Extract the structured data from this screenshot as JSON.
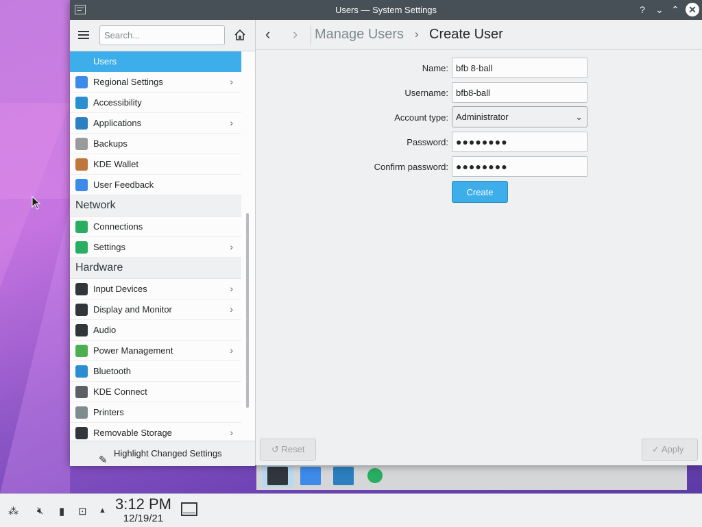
{
  "window": {
    "title": "Users — System Settings",
    "buttons": [
      "?",
      "⌄",
      "⌃",
      "✕"
    ]
  },
  "sidebar": {
    "search_placeholder": "Search...",
    "items_top": [
      {
        "label": "Users",
        "icon": "users-icon",
        "selected": true,
        "has_chevron": false,
        "color": "#3daee9"
      },
      {
        "label": "Regional Settings",
        "icon": "regional-settings-icon",
        "has_chevron": true,
        "color": "#3d8ae9"
      },
      {
        "label": "Accessibility",
        "icon": "accessibility-icon",
        "has_chevron": false,
        "color": "#2a8fd0"
      },
      {
        "label": "Applications",
        "icon": "applications-icon",
        "has_chevron": true,
        "color": "#2d7fc1"
      },
      {
        "label": "Backups",
        "icon": "backups-icon",
        "has_chevron": false,
        "color": "#9a9a9a"
      },
      {
        "label": "KDE Wallet",
        "icon": "kde-wallet-icon",
        "has_chevron": false,
        "color": "#c0763a"
      },
      {
        "label": "User Feedback",
        "icon": "user-feedback-icon",
        "has_chevron": false,
        "color": "#3d8ae9"
      }
    ],
    "category_network": "Network",
    "items_network": [
      {
        "label": "Connections",
        "icon": "connections-icon",
        "has_chevron": false,
        "color": "#27ae60"
      },
      {
        "label": "Settings",
        "icon": "network-settings-icon",
        "has_chevron": true,
        "color": "#27ae60"
      }
    ],
    "category_hardware": "Hardware",
    "items_hardware": [
      {
        "label": "Input Devices",
        "icon": "input-devices-icon",
        "has_chevron": true,
        "color": "#31363b"
      },
      {
        "label": "Display and Monitor",
        "icon": "display-monitor-icon",
        "has_chevron": true,
        "color": "#31363b"
      },
      {
        "label": "Audio",
        "icon": "audio-icon",
        "has_chevron": false,
        "color": "#31363b"
      },
      {
        "label": "Power Management",
        "icon": "power-management-icon",
        "has_chevron": true,
        "color": "#4caf50"
      },
      {
        "label": "Bluetooth",
        "icon": "bluetooth-icon",
        "has_chevron": false,
        "color": "#2a8fd0"
      },
      {
        "label": "KDE Connect",
        "icon": "kde-connect-icon",
        "has_chevron": false,
        "color": "#5c6064"
      },
      {
        "label": "Printers",
        "icon": "printers-icon",
        "has_chevron": false,
        "color": "#7f8c8d"
      },
      {
        "label": "Removable Storage",
        "icon": "removable-storage-icon",
        "has_chevron": true,
        "color": "#31363b"
      }
    ],
    "footer_label": "Highlight Changed Settings"
  },
  "main": {
    "breadcrumb_parent": "Manage Users",
    "breadcrumb_current": "Create User",
    "form": {
      "name_label": "Name:",
      "name_value": "bfb 8-ball",
      "username_label": "Username:",
      "username_value": "bfb8-ball",
      "account_type_label": "Account type:",
      "account_type_value": "Administrator",
      "password_label": "Password:",
      "password_value": "●●●●●●●●",
      "confirm_label": "Confirm password:",
      "confirm_value": "●●●●●●●●",
      "create_label": "Create"
    },
    "reset_label": "Reset",
    "apply_label": "Apply"
  },
  "panel": {
    "time": "3:12 PM",
    "date": "12/19/21"
  },
  "colors": {
    "accent": "#3daee9",
    "titlebar": "#475057"
  }
}
